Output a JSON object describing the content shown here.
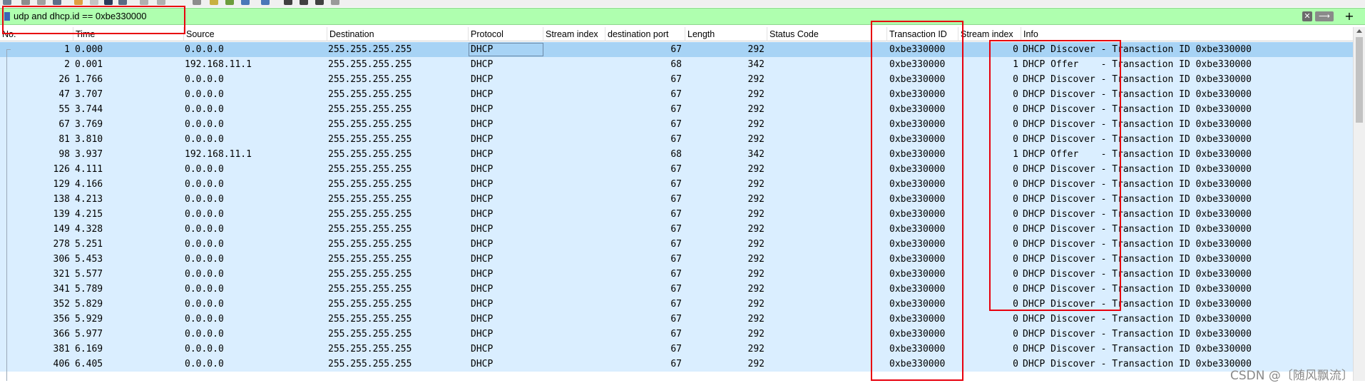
{
  "filter": {
    "value": "udp and dhcp.id == 0xbe330000",
    "clear_glyph": "✕",
    "apply_glyph": "⟶",
    "add_glyph": "+"
  },
  "columns": [
    {
      "key": "no",
      "label": "No."
    },
    {
      "key": "time",
      "label": "Time"
    },
    {
      "key": "source",
      "label": "Source"
    },
    {
      "key": "destination",
      "label": "Destination"
    },
    {
      "key": "protocol",
      "label": "Protocol"
    },
    {
      "key": "stream_index",
      "label": "Stream index"
    },
    {
      "key": "dest_port",
      "label": "destination port"
    },
    {
      "key": "length",
      "label": "Length"
    },
    {
      "key": "status_code",
      "label": "Status Code"
    },
    {
      "key": "transaction_id",
      "label": "Transaction ID"
    },
    {
      "key": "stream_index2",
      "label": "Stream index"
    },
    {
      "key": "info",
      "label": "Info"
    }
  ],
  "rows": [
    {
      "no": "1",
      "time": "0.000",
      "source": "0.0.0.0",
      "destination": "255.255.255.255",
      "protocol": "DHCP",
      "dest_port": "67",
      "length": "292",
      "transaction_id": "0xbe330000",
      "stream_index2": "0",
      "info": "DHCP Discover - Transaction ID 0xbe330000",
      "selected": true
    },
    {
      "no": "2",
      "time": "0.001",
      "source": "192.168.11.1",
      "destination": "255.255.255.255",
      "protocol": "DHCP",
      "dest_port": "68",
      "length": "342",
      "transaction_id": "0xbe330000",
      "stream_index2": "1",
      "info": "DHCP Offer    - Transaction ID 0xbe330000"
    },
    {
      "no": "26",
      "time": "1.766",
      "source": "0.0.0.0",
      "destination": "255.255.255.255",
      "protocol": "DHCP",
      "dest_port": "67",
      "length": "292",
      "transaction_id": "0xbe330000",
      "stream_index2": "0",
      "info": "DHCP Discover - Transaction ID 0xbe330000"
    },
    {
      "no": "47",
      "time": "3.707",
      "source": "0.0.0.0",
      "destination": "255.255.255.255",
      "protocol": "DHCP",
      "dest_port": "67",
      "length": "292",
      "transaction_id": "0xbe330000",
      "stream_index2": "0",
      "info": "DHCP Discover - Transaction ID 0xbe330000"
    },
    {
      "no": "55",
      "time": "3.744",
      "source": "0.0.0.0",
      "destination": "255.255.255.255",
      "protocol": "DHCP",
      "dest_port": "67",
      "length": "292",
      "transaction_id": "0xbe330000",
      "stream_index2": "0",
      "info": "DHCP Discover - Transaction ID 0xbe330000"
    },
    {
      "no": "67",
      "time": "3.769",
      "source": "0.0.0.0",
      "destination": "255.255.255.255",
      "protocol": "DHCP",
      "dest_port": "67",
      "length": "292",
      "transaction_id": "0xbe330000",
      "stream_index2": "0",
      "info": "DHCP Discover - Transaction ID 0xbe330000"
    },
    {
      "no": "81",
      "time": "3.810",
      "source": "0.0.0.0",
      "destination": "255.255.255.255",
      "protocol": "DHCP",
      "dest_port": "67",
      "length": "292",
      "transaction_id": "0xbe330000",
      "stream_index2": "0",
      "info": "DHCP Discover - Transaction ID 0xbe330000"
    },
    {
      "no": "98",
      "time": "3.937",
      "source": "192.168.11.1",
      "destination": "255.255.255.255",
      "protocol": "DHCP",
      "dest_port": "68",
      "length": "342",
      "transaction_id": "0xbe330000",
      "stream_index2": "1",
      "info": "DHCP Offer    - Transaction ID 0xbe330000"
    },
    {
      "no": "126",
      "time": "4.111",
      "source": "0.0.0.0",
      "destination": "255.255.255.255",
      "protocol": "DHCP",
      "dest_port": "67",
      "length": "292",
      "transaction_id": "0xbe330000",
      "stream_index2": "0",
      "info": "DHCP Discover - Transaction ID 0xbe330000"
    },
    {
      "no": "129",
      "time": "4.166",
      "source": "0.0.0.0",
      "destination": "255.255.255.255",
      "protocol": "DHCP",
      "dest_port": "67",
      "length": "292",
      "transaction_id": "0xbe330000",
      "stream_index2": "0",
      "info": "DHCP Discover - Transaction ID 0xbe330000"
    },
    {
      "no": "138",
      "time": "4.213",
      "source": "0.0.0.0",
      "destination": "255.255.255.255",
      "protocol": "DHCP",
      "dest_port": "67",
      "length": "292",
      "transaction_id": "0xbe330000",
      "stream_index2": "0",
      "info": "DHCP Discover - Transaction ID 0xbe330000"
    },
    {
      "no": "139",
      "time": "4.215",
      "source": "0.0.0.0",
      "destination": "255.255.255.255",
      "protocol": "DHCP",
      "dest_port": "67",
      "length": "292",
      "transaction_id": "0xbe330000",
      "stream_index2": "0",
      "info": "DHCP Discover - Transaction ID 0xbe330000"
    },
    {
      "no": "149",
      "time": "4.328",
      "source": "0.0.0.0",
      "destination": "255.255.255.255",
      "protocol": "DHCP",
      "dest_port": "67",
      "length": "292",
      "transaction_id": "0xbe330000",
      "stream_index2": "0",
      "info": "DHCP Discover - Transaction ID 0xbe330000"
    },
    {
      "no": "278",
      "time": "5.251",
      "source": "0.0.0.0",
      "destination": "255.255.255.255",
      "protocol": "DHCP",
      "dest_port": "67",
      "length": "292",
      "transaction_id": "0xbe330000",
      "stream_index2": "0",
      "info": "DHCP Discover - Transaction ID 0xbe330000"
    },
    {
      "no": "306",
      "time": "5.453",
      "source": "0.0.0.0",
      "destination": "255.255.255.255",
      "protocol": "DHCP",
      "dest_port": "67",
      "length": "292",
      "transaction_id": "0xbe330000",
      "stream_index2": "0",
      "info": "DHCP Discover - Transaction ID 0xbe330000"
    },
    {
      "no": "321",
      "time": "5.577",
      "source": "0.0.0.0",
      "destination": "255.255.255.255",
      "protocol": "DHCP",
      "dest_port": "67",
      "length": "292",
      "transaction_id": "0xbe330000",
      "stream_index2": "0",
      "info": "DHCP Discover - Transaction ID 0xbe330000"
    },
    {
      "no": "341",
      "time": "5.789",
      "source": "0.0.0.0",
      "destination": "255.255.255.255",
      "protocol": "DHCP",
      "dest_port": "67",
      "length": "292",
      "transaction_id": "0xbe330000",
      "stream_index2": "0",
      "info": "DHCP Discover - Transaction ID 0xbe330000"
    },
    {
      "no": "352",
      "time": "5.829",
      "source": "0.0.0.0",
      "destination": "255.255.255.255",
      "protocol": "DHCP",
      "dest_port": "67",
      "length": "292",
      "transaction_id": "0xbe330000",
      "stream_index2": "0",
      "info": "DHCP Discover - Transaction ID 0xbe330000"
    },
    {
      "no": "356",
      "time": "5.929",
      "source": "0.0.0.0",
      "destination": "255.255.255.255",
      "protocol": "DHCP",
      "dest_port": "67",
      "length": "292",
      "transaction_id": "0xbe330000",
      "stream_index2": "0",
      "info": "DHCP Discover - Transaction ID 0xbe330000"
    },
    {
      "no": "366",
      "time": "5.977",
      "source": "0.0.0.0",
      "destination": "255.255.255.255",
      "protocol": "DHCP",
      "dest_port": "67",
      "length": "292",
      "transaction_id": "0xbe330000",
      "stream_index2": "0",
      "info": "DHCP Discover - Transaction ID 0xbe330000"
    },
    {
      "no": "381",
      "time": "6.169",
      "source": "0.0.0.0",
      "destination": "255.255.255.255",
      "protocol": "DHCP",
      "dest_port": "67",
      "length": "292",
      "transaction_id": "0xbe330000",
      "stream_index2": "0",
      "info": "DHCP Discover - Transaction ID 0xbe330000"
    },
    {
      "no": "406",
      "time": "6.405",
      "source": "0.0.0.0",
      "destination": "255.255.255.255",
      "protocol": "DHCP",
      "dest_port": "67",
      "length": "292",
      "transaction_id": "0xbe330000",
      "stream_index2": "0",
      "info": "DHCP Discover - Transaction ID 0xbe330000"
    }
  ],
  "watermark": "CSDN @〔随风飘流〕",
  "colors": {
    "filter_bg": "#afffaf",
    "row_bg": "#daeeff",
    "row_selected_bg": "#a7d3f5",
    "annotation_red": "#e8000d"
  }
}
